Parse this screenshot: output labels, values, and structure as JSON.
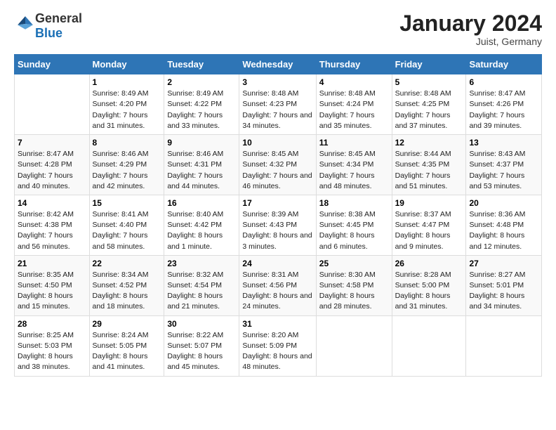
{
  "header": {
    "logo_general": "General",
    "logo_blue": "Blue",
    "month_title": "January 2024",
    "subtitle": "Juist, Germany"
  },
  "days_of_week": [
    "Sunday",
    "Monday",
    "Tuesday",
    "Wednesday",
    "Thursday",
    "Friday",
    "Saturday"
  ],
  "weeks": [
    [
      {
        "day": "",
        "info": ""
      },
      {
        "day": "1",
        "info": "Sunrise: 8:49 AM\nSunset: 4:20 PM\nDaylight: 7 hours\nand 31 minutes."
      },
      {
        "day": "2",
        "info": "Sunrise: 8:49 AM\nSunset: 4:22 PM\nDaylight: 7 hours\nand 33 minutes."
      },
      {
        "day": "3",
        "info": "Sunrise: 8:48 AM\nSunset: 4:23 PM\nDaylight: 7 hours\nand 34 minutes."
      },
      {
        "day": "4",
        "info": "Sunrise: 8:48 AM\nSunset: 4:24 PM\nDaylight: 7 hours\nand 35 minutes."
      },
      {
        "day": "5",
        "info": "Sunrise: 8:48 AM\nSunset: 4:25 PM\nDaylight: 7 hours\nand 37 minutes."
      },
      {
        "day": "6",
        "info": "Sunrise: 8:47 AM\nSunset: 4:26 PM\nDaylight: 7 hours\nand 39 minutes."
      }
    ],
    [
      {
        "day": "7",
        "info": "Sunrise: 8:47 AM\nSunset: 4:28 PM\nDaylight: 7 hours\nand 40 minutes."
      },
      {
        "day": "8",
        "info": "Sunrise: 8:46 AM\nSunset: 4:29 PM\nDaylight: 7 hours\nand 42 minutes."
      },
      {
        "day": "9",
        "info": "Sunrise: 8:46 AM\nSunset: 4:31 PM\nDaylight: 7 hours\nand 44 minutes."
      },
      {
        "day": "10",
        "info": "Sunrise: 8:45 AM\nSunset: 4:32 PM\nDaylight: 7 hours\nand 46 minutes."
      },
      {
        "day": "11",
        "info": "Sunrise: 8:45 AM\nSunset: 4:34 PM\nDaylight: 7 hours\nand 48 minutes."
      },
      {
        "day": "12",
        "info": "Sunrise: 8:44 AM\nSunset: 4:35 PM\nDaylight: 7 hours\nand 51 minutes."
      },
      {
        "day": "13",
        "info": "Sunrise: 8:43 AM\nSunset: 4:37 PM\nDaylight: 7 hours\nand 53 minutes."
      }
    ],
    [
      {
        "day": "14",
        "info": "Sunrise: 8:42 AM\nSunset: 4:38 PM\nDaylight: 7 hours\nand 56 minutes."
      },
      {
        "day": "15",
        "info": "Sunrise: 8:41 AM\nSunset: 4:40 PM\nDaylight: 7 hours\nand 58 minutes."
      },
      {
        "day": "16",
        "info": "Sunrise: 8:40 AM\nSunset: 4:42 PM\nDaylight: 8 hours\nand 1 minute."
      },
      {
        "day": "17",
        "info": "Sunrise: 8:39 AM\nSunset: 4:43 PM\nDaylight: 8 hours\nand 3 minutes."
      },
      {
        "day": "18",
        "info": "Sunrise: 8:38 AM\nSunset: 4:45 PM\nDaylight: 8 hours\nand 6 minutes."
      },
      {
        "day": "19",
        "info": "Sunrise: 8:37 AM\nSunset: 4:47 PM\nDaylight: 8 hours\nand 9 minutes."
      },
      {
        "day": "20",
        "info": "Sunrise: 8:36 AM\nSunset: 4:48 PM\nDaylight: 8 hours\nand 12 minutes."
      }
    ],
    [
      {
        "day": "21",
        "info": "Sunrise: 8:35 AM\nSunset: 4:50 PM\nDaylight: 8 hours\nand 15 minutes."
      },
      {
        "day": "22",
        "info": "Sunrise: 8:34 AM\nSunset: 4:52 PM\nDaylight: 8 hours\nand 18 minutes."
      },
      {
        "day": "23",
        "info": "Sunrise: 8:32 AM\nSunset: 4:54 PM\nDaylight: 8 hours\nand 21 minutes."
      },
      {
        "day": "24",
        "info": "Sunrise: 8:31 AM\nSunset: 4:56 PM\nDaylight: 8 hours\nand 24 minutes."
      },
      {
        "day": "25",
        "info": "Sunrise: 8:30 AM\nSunset: 4:58 PM\nDaylight: 8 hours\nand 28 minutes."
      },
      {
        "day": "26",
        "info": "Sunrise: 8:28 AM\nSunset: 5:00 PM\nDaylight: 8 hours\nand 31 minutes."
      },
      {
        "day": "27",
        "info": "Sunrise: 8:27 AM\nSunset: 5:01 PM\nDaylight: 8 hours\nand 34 minutes."
      }
    ],
    [
      {
        "day": "28",
        "info": "Sunrise: 8:25 AM\nSunset: 5:03 PM\nDaylight: 8 hours\nand 38 minutes."
      },
      {
        "day": "29",
        "info": "Sunrise: 8:24 AM\nSunset: 5:05 PM\nDaylight: 8 hours\nand 41 minutes."
      },
      {
        "day": "30",
        "info": "Sunrise: 8:22 AM\nSunset: 5:07 PM\nDaylight: 8 hours\nand 45 minutes."
      },
      {
        "day": "31",
        "info": "Sunrise: 8:20 AM\nSunset: 5:09 PM\nDaylight: 8 hours\nand 48 minutes."
      },
      {
        "day": "",
        "info": ""
      },
      {
        "day": "",
        "info": ""
      },
      {
        "day": "",
        "info": ""
      }
    ]
  ]
}
